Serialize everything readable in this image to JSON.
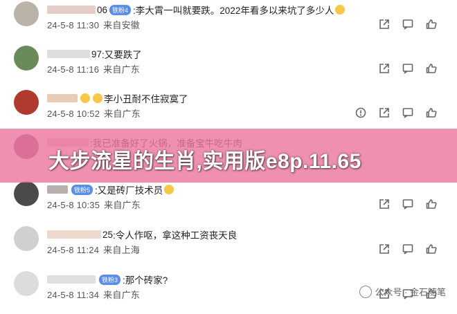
{
  "comments": [
    {
      "user_suffix": "06",
      "badge": "铁粉4",
      "text": ":李大霄一叫就要跌。2022年看多以来坑了多少人",
      "date": "24-5-8 11:30",
      "location": "来自安徽",
      "actions": [
        "share-icon",
        "comment-icon",
        "like-icon"
      ]
    },
    {
      "user_suffix": "97",
      "badge": "",
      "text": ":又要跌了",
      "date": "24-5-8 11:16",
      "location": "来自广东",
      "actions": [
        "share-icon",
        "comment-icon",
        "like-icon"
      ]
    },
    {
      "user_suffix": "",
      "badge": "",
      "text": "李小丑耐不住寂寞了",
      "date": "24-5-8 10:52",
      "location": "来自广东",
      "actions": [
        "report-icon",
        "share-icon",
        "comment-icon",
        "like-icon"
      ]
    },
    {
      "user_suffix": "",
      "badge": "",
      "text": ":我已准备好了火锅，准备宝牛吃牛肉",
      "date": "",
      "location": "",
      "actions": []
    },
    {
      "user_suffix": "",
      "badge": "铁粉5",
      "text": ":又是砖厂技术员",
      "date": "24-5-8 10:35",
      "location": "来自广东",
      "actions": [
        "share-icon",
        "comment-icon",
        "like-icon"
      ]
    },
    {
      "user_suffix": "25",
      "badge": "",
      "text": ":令人作呕，拿这种工资丧天良",
      "date": "24-5-8 11:24",
      "location": "来自上海",
      "actions": [
        "share-icon",
        "comment-icon",
        "like-icon"
      ]
    },
    {
      "user_suffix": "",
      "badge": "铁粉3",
      "text": ":那个砖家?",
      "date": "24-5-8 11:34",
      "location": "来自广东",
      "actions": [
        "share-icon",
        "comment-icon",
        "like-icon"
      ]
    }
  ],
  "banner": {
    "text": "大步流星的生肖,实用版e8p.11.65"
  },
  "watermark": {
    "text": "公众号 · 金石随笔"
  },
  "colors": {
    "banner": "#ec78a0",
    "badge": "#5b8ee6"
  }
}
